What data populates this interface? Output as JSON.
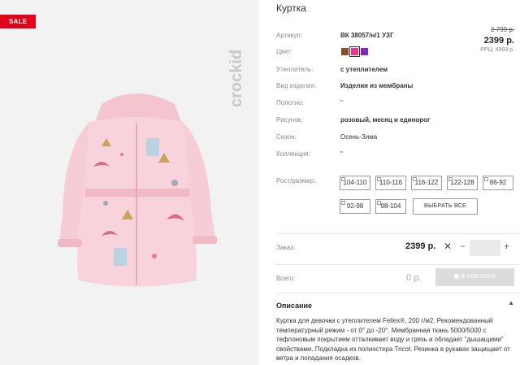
{
  "badge": {
    "sale": "SALE"
  },
  "brand": {
    "name": "crockid"
  },
  "product": {
    "title": "Куртка",
    "price_old": "2 799 р.",
    "price_new": "2399 р.",
    "price_rrp": "РРЦ: 4999 р."
  },
  "attributes": [
    {
      "label": "Артикул:",
      "value": "ВК 38057/н/1 УЗГ",
      "bold": true
    },
    {
      "label": "Цвет:",
      "value": "",
      "bold": false
    },
    {
      "label": "Утеплитель:",
      "value": "с утеплителем",
      "bold": true
    },
    {
      "label": "Вид изделия:",
      "value": "Изделия из мембраны",
      "bold": true
    },
    {
      "label": "Полотно:",
      "value": "\"",
      "bold": false
    },
    {
      "label": "Рисунок:",
      "value": "розовый, месяц и единорог",
      "bold": true
    },
    {
      "label": "Сезон:",
      "value": "Осень-Зима",
      "bold": false
    },
    {
      "label": "Коллекция:",
      "value": "\"",
      "bold": false
    }
  ],
  "colors": [
    "#8b4a2b",
    "#e8388a",
    "#7a2bb8"
  ],
  "sizes": {
    "label": "Рост/размер:",
    "options": [
      "104-110",
      "110-116",
      "116-122",
      "122-128",
      "86-92",
      "92-98",
      "98-104"
    ],
    "select_all": "ВЫБРАТЬ ВСЕ"
  },
  "order": {
    "label": "Заказ:",
    "price": "2399 р.",
    "remove": "✕",
    "minus": "−",
    "plus": "+",
    "qty": ""
  },
  "total": {
    "label": "Всего:",
    "price": "0 р.",
    "cart_button": "В КОРЗИНУ"
  },
  "description": {
    "title": "Описание",
    "text": "Куртка для девочки с утеплителем Fellex®, 200 г/м2. Рекомендованный температурный режим - от 0° до -20°. Мембранная ткань 5000/5000 с тефлоновым покрытием отталкивает воду и грязь и обладает \"дышащими\" свойствами. Подкладка из полиэстера Tricot. Резинка в рукавах защищает от ветра и попадания осадков."
  },
  "theme": {
    "accent": "#e2001a",
    "jacket": "#f6cdd6"
  }
}
